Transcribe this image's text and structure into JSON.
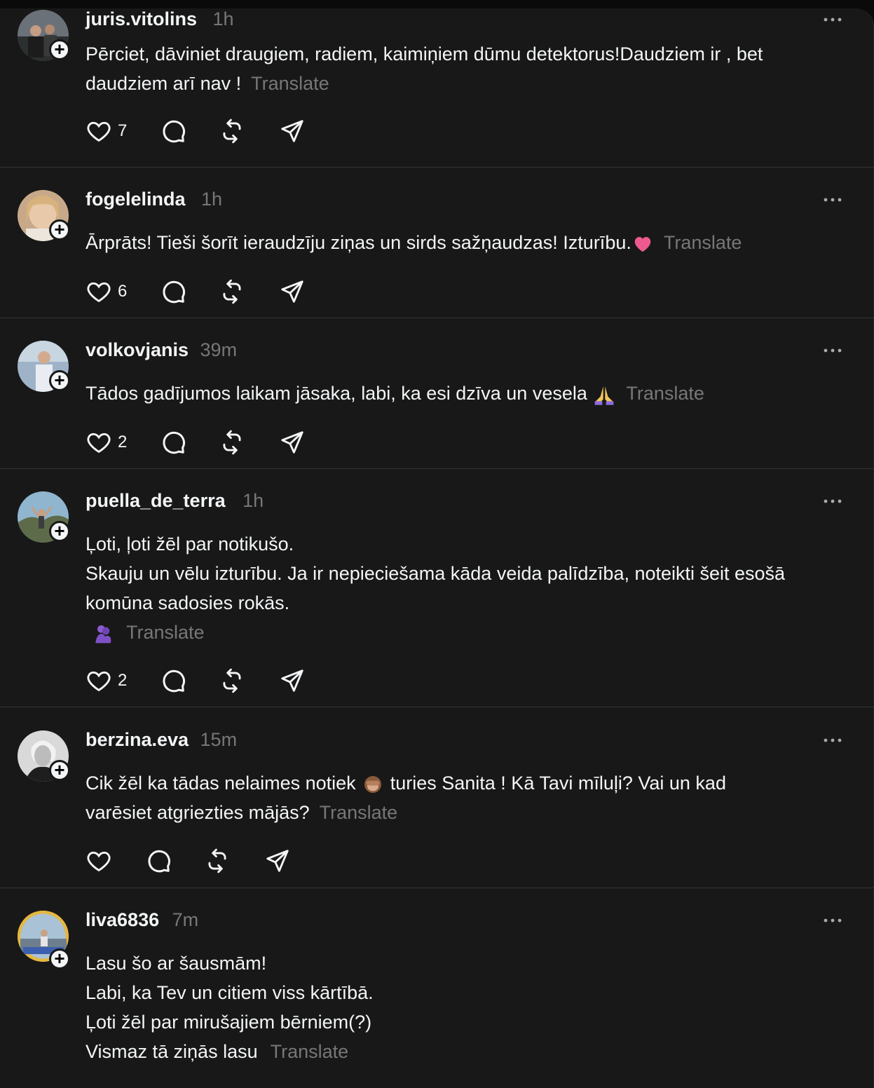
{
  "posts": [
    {
      "username": "juris.vitolins",
      "time": "1h",
      "lines": [
        "Pērciet, dāviniet draugiem, radiem, kaimiņiem dūmu detektorus!Daudziem ir , bet",
        "daudziem arī nav !"
      ],
      "translate": "Translate",
      "likes": "7"
    },
    {
      "username": "fogelelinda",
      "time": "1h",
      "lines": [
        "Ārprāts! Tieši šorīt ieraudzīju ziņas un sirds sažņaudzas! Izturību."
      ],
      "emoji": "heart",
      "translate": "Translate",
      "likes": "6"
    },
    {
      "username": "volkovjanis",
      "time": "39m",
      "lines": [
        "Tādos gadījumos laikam jāsaka, labi, ka esi dzīva un vesela"
      ],
      "emoji": "folded-hands",
      "translate": "Translate",
      "likes": "2"
    },
    {
      "username": "puella_de_terra",
      "time": "1h",
      "lines": [
        "Ļoti, ļoti žēl par notikušo.",
        "Skauju un vēlu izturību. Ja ir nepieciešama kāda veida palīdzība, noteikti šeit esošā",
        "komūna sadosies rokās."
      ],
      "emoji": "hug",
      "translate": "Translate",
      "likes": "2"
    },
    {
      "username": "berzina.eva",
      "time": "15m",
      "lines_before": "Cik žēl ka tādas nelaimes notiek",
      "emoji": "see-no-evil-monkey",
      "lines_after": "turies Sanita ! Kā Tavi mīluļi? Vai un kad",
      "line2": "varēsiet atgriezties mājās?",
      "translate": "Translate",
      "likes": ""
    },
    {
      "username": "liva6836",
      "time": "7m",
      "lines": [
        "Lasu šo ar šausmām!",
        "Labi, ka Tev un citiem viss kārtībā.",
        "Ļoti žēl par mirušajiem bērniem(?)",
        "Vismaz tā ziņās lasu"
      ],
      "translate": "Translate"
    }
  ],
  "colors": {
    "background": "#181818",
    "text": "#f3f5f7",
    "secondary": "#777777",
    "divider": "#333638"
  },
  "icons": [
    "heart-icon",
    "comment-icon",
    "repost-icon",
    "share-icon",
    "more-icon",
    "follow-plus-icon"
  ]
}
